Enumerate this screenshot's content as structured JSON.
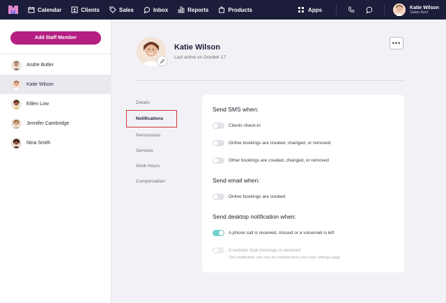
{
  "nav": {
    "items": [
      {
        "label": "Calendar",
        "icon": "calendar-icon"
      },
      {
        "label": "Clients",
        "icon": "clients-icon"
      },
      {
        "label": "Sales",
        "icon": "tag-icon"
      },
      {
        "label": "Inbox",
        "icon": "inbox-icon"
      },
      {
        "label": "Reports",
        "icon": "bar-chart-icon"
      },
      {
        "label": "Products",
        "icon": "bag-icon"
      }
    ],
    "apps_label": "Apps",
    "user": {
      "name": "Katie Wilson",
      "salon": "Salon Azul"
    }
  },
  "sidebar": {
    "add_button": "Add Staff Member",
    "staff": [
      {
        "name": "Andre Butler",
        "color": "#c99174"
      },
      {
        "name": "Katie Wilson",
        "color": "#e0a98c",
        "active": true
      },
      {
        "name": "Eillen Low",
        "color": "#a35d3c"
      },
      {
        "name": "Jennifer Cambridge",
        "color": "#d6a27b"
      },
      {
        "name": "Nina Smith",
        "color": "#5a2e22"
      }
    ]
  },
  "profile": {
    "name": "Katie Wilson",
    "last_active": "Last active on October 17",
    "more": "•••"
  },
  "subnav": [
    "Details",
    "Notifications",
    "Permissions",
    "Services",
    "Work Hours",
    "Compensation"
  ],
  "settings": {
    "sms_title": "Send SMS when:",
    "sms_options": [
      "Clients check-in",
      "Online bookings are created, changed, or removed",
      "Other bookings are created, changed, or removed"
    ],
    "email_title": "Send email when:",
    "email_options": [
      "Online bookings are created"
    ],
    "desktop_title": "Send desktop notification when:",
    "desktop_options": [
      "A phone call is received, missed or a voicemail is left",
      "A website chat message is received"
    ],
    "desktop_helper": "This notification can only be enabled from your user settings page"
  },
  "colors": {
    "nav_bg": "#1c1c3b",
    "accent": "#b51f82",
    "toggle_on": "#6fd3cf",
    "highlight": "#d63031"
  }
}
